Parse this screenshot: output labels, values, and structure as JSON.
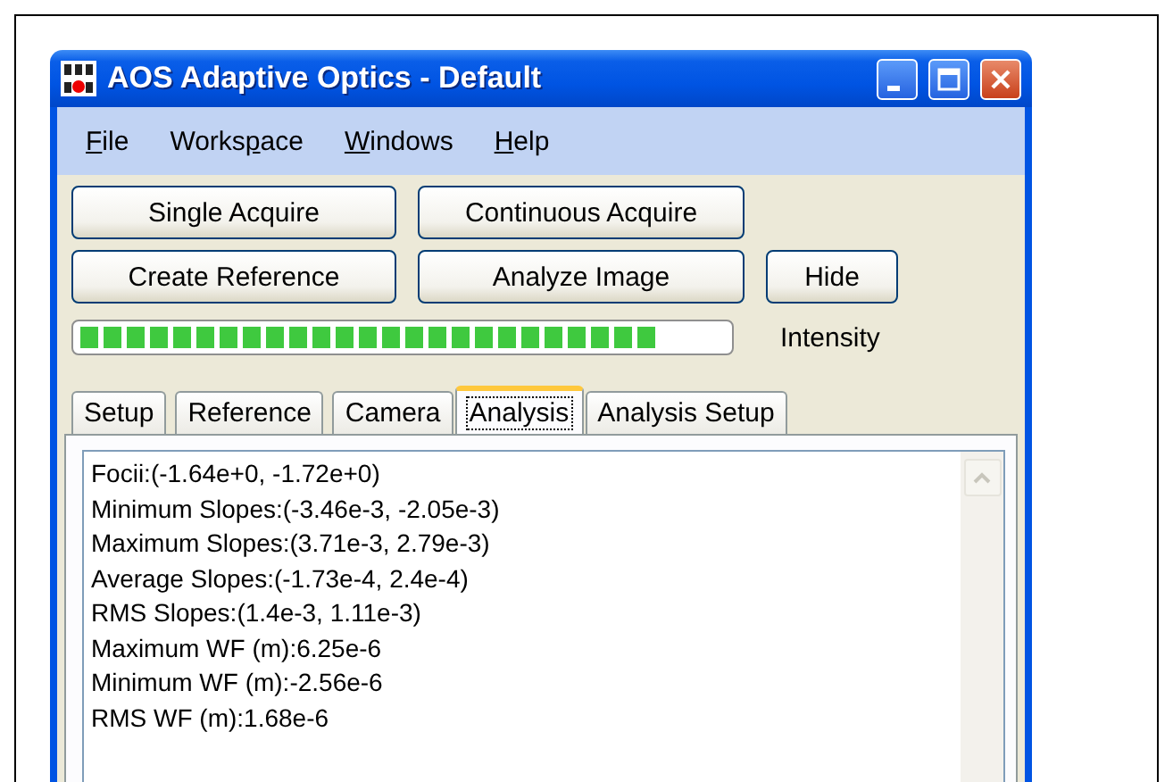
{
  "window": {
    "title": "AOS Adaptive Optics - Default"
  },
  "menu": [
    {
      "mnemonic": "F",
      "after": "ile"
    },
    {
      "before": "Works",
      "mnemonic": "p",
      "after": "ace"
    },
    {
      "mnemonic": "W",
      "after": "indows"
    },
    {
      "mnemonic": "H",
      "after": "elp"
    }
  ],
  "button_rows": [
    [
      "Single Acquire",
      "Continuous Acquire"
    ],
    [
      "Create Reference",
      "Analyze Image",
      "Hide"
    ]
  ],
  "intensity": {
    "level": 0.9,
    "label": "Intensity"
  },
  "tabs": [
    {
      "label": "Setup",
      "selected": false
    },
    {
      "label": "Reference",
      "selected": false
    },
    {
      "label": "Camera",
      "selected": false
    },
    {
      "label": "Analysis",
      "selected": true
    },
    {
      "label": "Analysis Setup",
      "selected": false
    }
  ],
  "results": [
    "Focii:(-1.64e+0, -1.72e+0)",
    "Minimum Slopes:(-3.46e-3, -2.05e-3)",
    "Maximum Slopes:(3.71e-3, 2.79e-3)",
    "Average Slopes:(-1.73e-4, 2.4e-4)",
    "RMS Slopes:(1.4e-3, 1.11e-3)",
    "Maximum WF (m):6.25e-6",
    "Minimum WF (m):-2.56e-6",
    "RMS WF (m):1.68e-6"
  ]
}
